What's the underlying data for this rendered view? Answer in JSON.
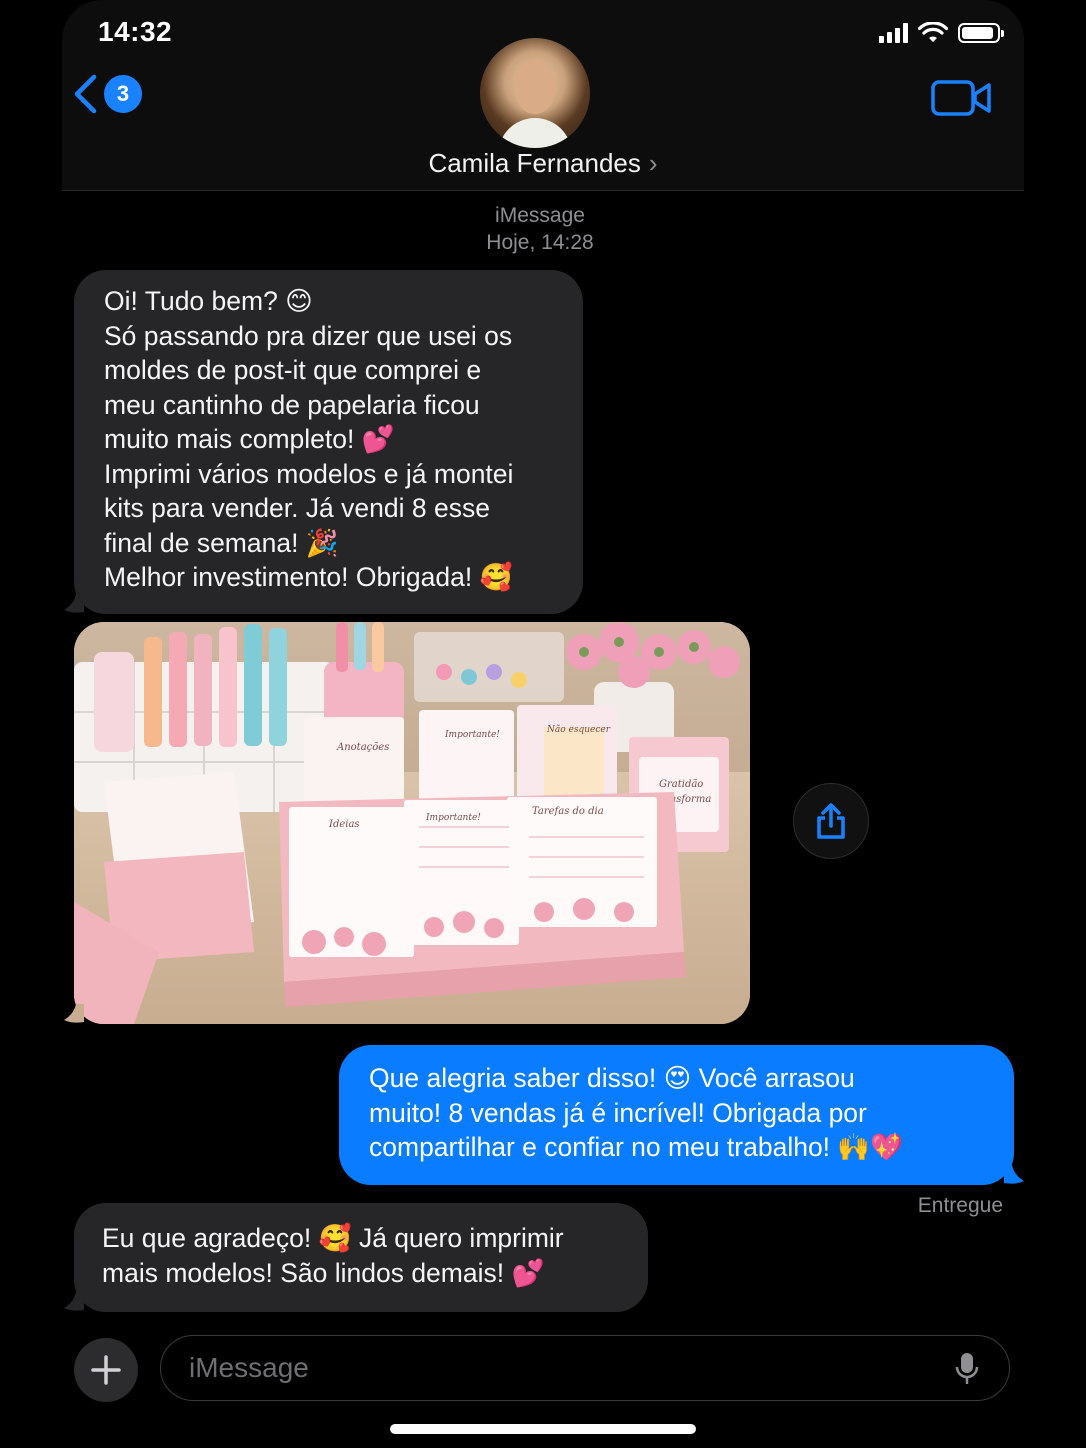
{
  "status_bar": {
    "time": "14:32"
  },
  "header": {
    "back_badge": "3",
    "contact_name": "Camila Fernandes",
    "chevron": "›"
  },
  "meta": {
    "service": "iMessage",
    "timestamp": "Hoje, 14:28"
  },
  "messages": [
    {
      "direction": "incoming",
      "lines": [
        "Oi! Tudo bem? 😊",
        "Só passando pra dizer que usei os",
        "moldes de post-it que comprei e",
        "meu cantinho de papelaria ficou",
        "muito mais completo! 💕",
        "Imprimi vários modelos e já montei",
        "kits para vender. Já vendi 8 esse",
        "final de semana! 🎉",
        "Melhor investimento! Obrigada! 🥰"
      ]
    },
    {
      "direction": "outgoing",
      "lines": [
        "Que alegria saber disso! 😍 Você arrasou",
        "muito! 8 vendas já é incrível! Obrigada por",
        "compartilhar e confiar no meu trabalho! 🙌💖"
      ],
      "status": "Entregue"
    },
    {
      "direction": "incoming",
      "lines": [
        "Eu que agradeço! 🥰 Já quero imprimir",
        "mais modelos! São lindos demais! 💕"
      ]
    }
  ],
  "photo": {
    "notepads": [
      {
        "label": "Anotações"
      },
      {
        "label": "Importante!"
      },
      {
        "label": "Não esquecer"
      },
      {
        "label": "Ideias"
      },
      {
        "label": "Importante!"
      },
      {
        "label": "Tarefas do dia"
      },
      {
        "label": "Gratidão transforma"
      }
    ]
  },
  "input": {
    "placeholder": "iMessage"
  },
  "colors": {
    "accent": "#0a7cff",
    "incoming_bubble": "#262628",
    "badge": "#1a82ff"
  },
  "icons": [
    "back-chevron-icon",
    "video-camera-icon",
    "share-icon",
    "plus-icon",
    "microphone-icon"
  ]
}
